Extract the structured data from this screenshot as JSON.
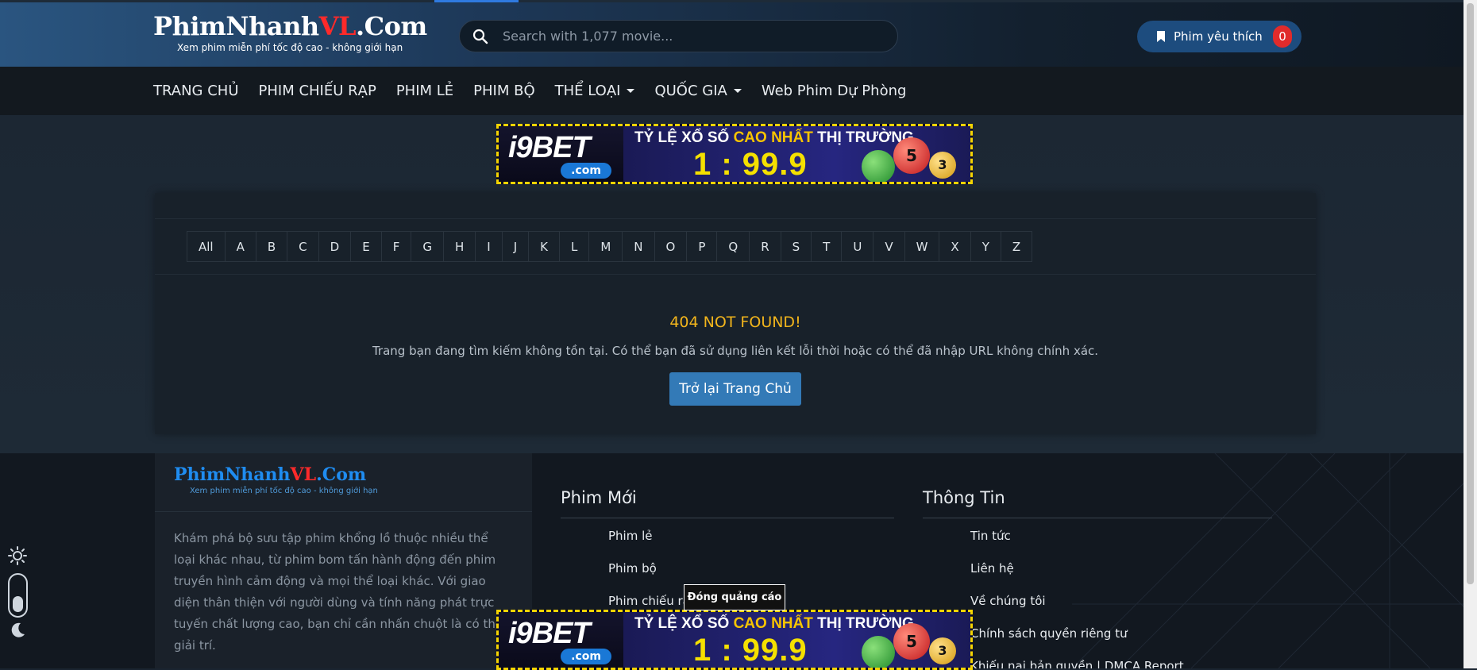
{
  "header": {
    "logo_main": "PhimNhanh",
    "logo_accent": "VL",
    "logo_suffix": ".Com",
    "logo_tagline": "Xem phim miễn phí tốc độ cao - không giới hạn",
    "search_placeholder": "Search with 1,077 movie...",
    "favorites_label": "Phim yêu thích",
    "favorites_count": "0"
  },
  "nav": {
    "items": [
      {
        "label": "TRANG CHỦ"
      },
      {
        "label": "PHIM CHIẾU RẠP"
      },
      {
        "label": "PHIM LẺ"
      },
      {
        "label": "PHIM BỘ"
      },
      {
        "label": "THỂ LOẠI"
      },
      {
        "label": "QUỐC GIA"
      },
      {
        "label": "Web Phim Dự Phòng"
      }
    ]
  },
  "ad": {
    "brand": "i9BET",
    "domain": ".com",
    "tagline_pre": "TỶ LỆ XỔ SỐ ",
    "tagline_hl": "CAO NHẤT",
    "tagline_post": " THỊ TRƯỜNG",
    "odds": "1 : 99.9",
    "ball_1": "5",
    "ball_2": "3",
    "close_label": "Đóng quảng cáo"
  },
  "alphabet": [
    "All",
    "A",
    "B",
    "C",
    "D",
    "E",
    "F",
    "G",
    "H",
    "I",
    "J",
    "K",
    "L",
    "M",
    "N",
    "O",
    "P",
    "Q",
    "R",
    "S",
    "T",
    "U",
    "V",
    "W",
    "X",
    "Y",
    "Z"
  ],
  "not_found": {
    "title": "404 NOT FOUND!",
    "message": "Trang bạn đang tìm kiếm không tồn tại. Có thể bạn đã sử dụng liên kết lỗi thời hoặc có thể đã nhập URL không chính xác.",
    "button": "Trở lại Trang Chủ"
  },
  "footer": {
    "logo_main": "PhimNhanh",
    "logo_accent": "VL",
    "logo_suffix": ".Com",
    "logo_tagline": "Xem phim miễn phí tốc độ cao - không giới hạn",
    "description": "Khám phá bộ sưu tập phim khổng lồ thuộc nhiều thể loại khác nhau, từ phim bom tấn hành động đến phim truyền hình cảm động và mọi thể loại khác. Với giao diện thân thiện với người dùng và tính năng phát trực tuyến chất lượng cao, bạn chỉ cần nhấn chuột là có thể giải trí.",
    "new_movies_title": "Phim Mới",
    "new_movies_links": [
      "Phim lẻ",
      "Phim bộ",
      "Phim chiếu rạp"
    ],
    "info_title": "Thông Tin",
    "info_links": [
      "Tin tức",
      "Liên hệ",
      "Về chúng tôi",
      "Chính sách quyền riêng tư",
      "Khiếu nại bản quyền | DMCA Report"
    ]
  },
  "colors": {
    "accent": "#337ab7",
    "not_found": "#f2b51c",
    "badge": "#e02b2b",
    "logo_accent": "#ff2a2a"
  }
}
